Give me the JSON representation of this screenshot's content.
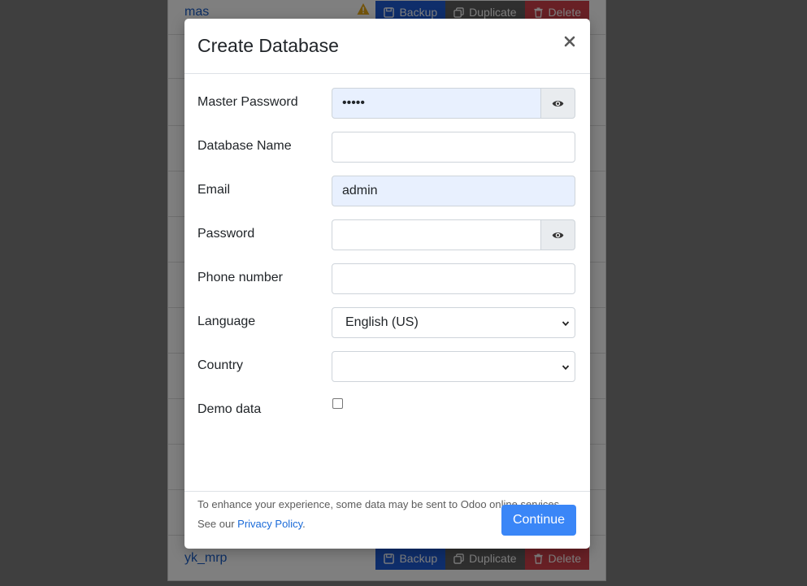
{
  "background": {
    "databases": [
      {
        "name": "mas",
        "warning": true
      },
      {
        "name": "yk_mrp",
        "warning": false
      }
    ],
    "actions": {
      "backup_label": "Backup",
      "duplicate_label": "Duplicate",
      "delete_label": "Delete"
    }
  },
  "modal": {
    "title": "Create Database",
    "close_icon": "close-icon",
    "fields": {
      "master_password": {
        "label": "Master Password",
        "value": "•••••"
      },
      "database_name": {
        "label": "Database Name",
        "value": ""
      },
      "email": {
        "label": "Email",
        "value": "admin"
      },
      "password": {
        "label": "Password",
        "value": ""
      },
      "phone_number": {
        "label": "Phone number",
        "value": ""
      },
      "language": {
        "label": "Language",
        "value": "English (US)"
      },
      "country": {
        "label": "Country",
        "value": ""
      },
      "demo_data": {
        "label": "Demo data",
        "checked": false
      }
    },
    "notice": {
      "text": "To enhance your experience, some data may be sent to Odoo online services.",
      "see_our": "See our",
      "policy_link": "Privacy Policy",
      "period": "."
    },
    "continue_label": "Continue"
  },
  "colors": {
    "primary": "#3a86f7",
    "backup": "#1e5cd6",
    "duplicate": "#5e5e5e",
    "delete": "#d0414b",
    "autofill": "#e8f0fe"
  }
}
